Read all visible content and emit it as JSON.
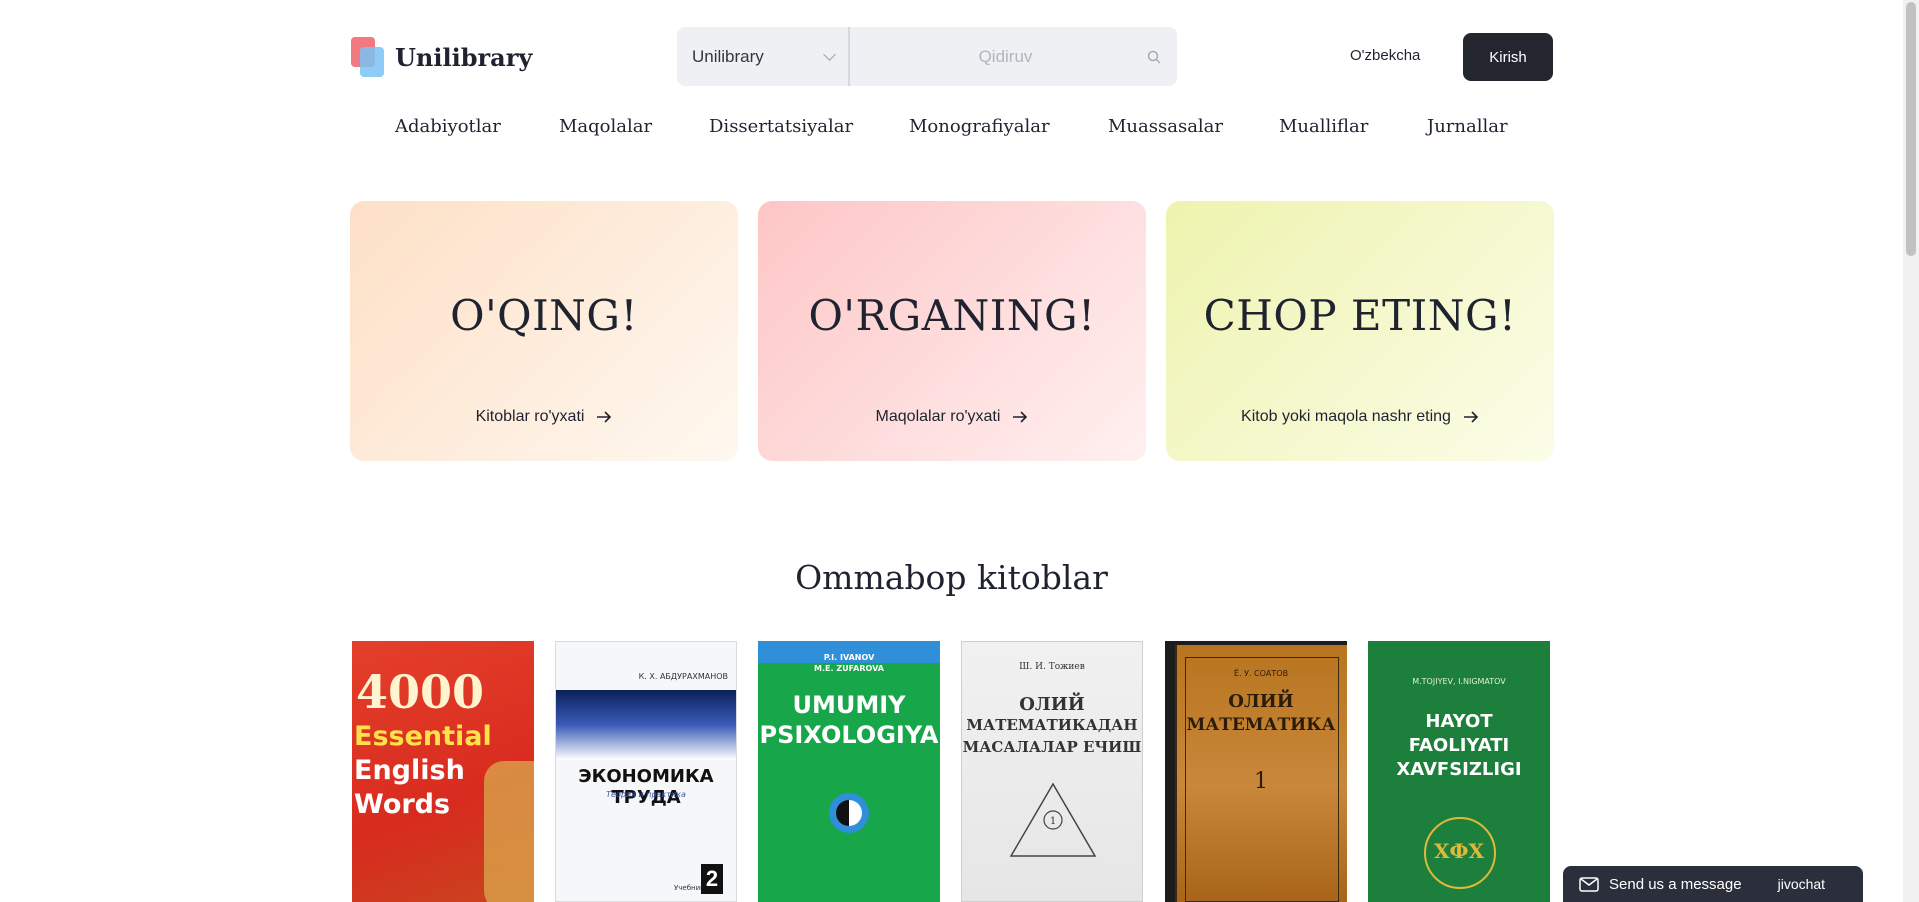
{
  "header": {
    "logo_text": "Unilibrary",
    "search_scope": "Unilibrary",
    "search_placeholder": "Qidiruv",
    "language": "O'zbekcha",
    "login_label": "Kirish"
  },
  "nav": {
    "items": [
      "Adabiyotlar",
      "Maqolalar",
      "Dissertatsiyalar",
      "Monografiyalar",
      "Muassasalar",
      "Mualliflar",
      "Jurnallar"
    ]
  },
  "cards": [
    {
      "title": "O'QING!",
      "link": "Kitoblar ro'yxati"
    },
    {
      "title": "O'RGANING!",
      "link": "Maqolalar ro'yxati"
    },
    {
      "title": "CHOP ETING!",
      "link": "Kitob yoki maqola nashr eting"
    }
  ],
  "section": {
    "title": "Ommabop kitoblar"
  },
  "books": [
    {
      "cover_lines": [
        "4000",
        "Essential",
        "English",
        "Words"
      ]
    },
    {
      "author": "К. Х. АБДУРАХМАНОВ",
      "title": "ЭКОНОМИКА ТРУДА",
      "subtitle": "Теория и практика",
      "label": "Учебник"
    },
    {
      "authors": [
        "P.I. IVANOV",
        "M.E. ZUFAROVA"
      ],
      "title_lines": [
        "UMUMIY",
        "PSIXOLOGIYA"
      ]
    },
    {
      "author": "Ш. И. Тожиев",
      "title_lines": [
        "ОЛИЙ",
        "МАТЕМАТИКАДАН",
        "МАСАЛАЛАР ЕЧИШ"
      ]
    },
    {
      "author": "Ё. У. СОАТОВ",
      "title_lines": [
        "ОЛИЙ",
        "МАТЕМАТИКА"
      ],
      "volume": "1"
    },
    {
      "author": "M.TOJIYEV, I.NIGMATOV",
      "title_lines": [
        "HAYOT",
        "FAOLIYATI",
        "XAVFSIZLIGI"
      ],
      "emblem": "ХФХ"
    }
  ],
  "chat": {
    "label": "Send us a message",
    "brand": "jivochat"
  }
}
